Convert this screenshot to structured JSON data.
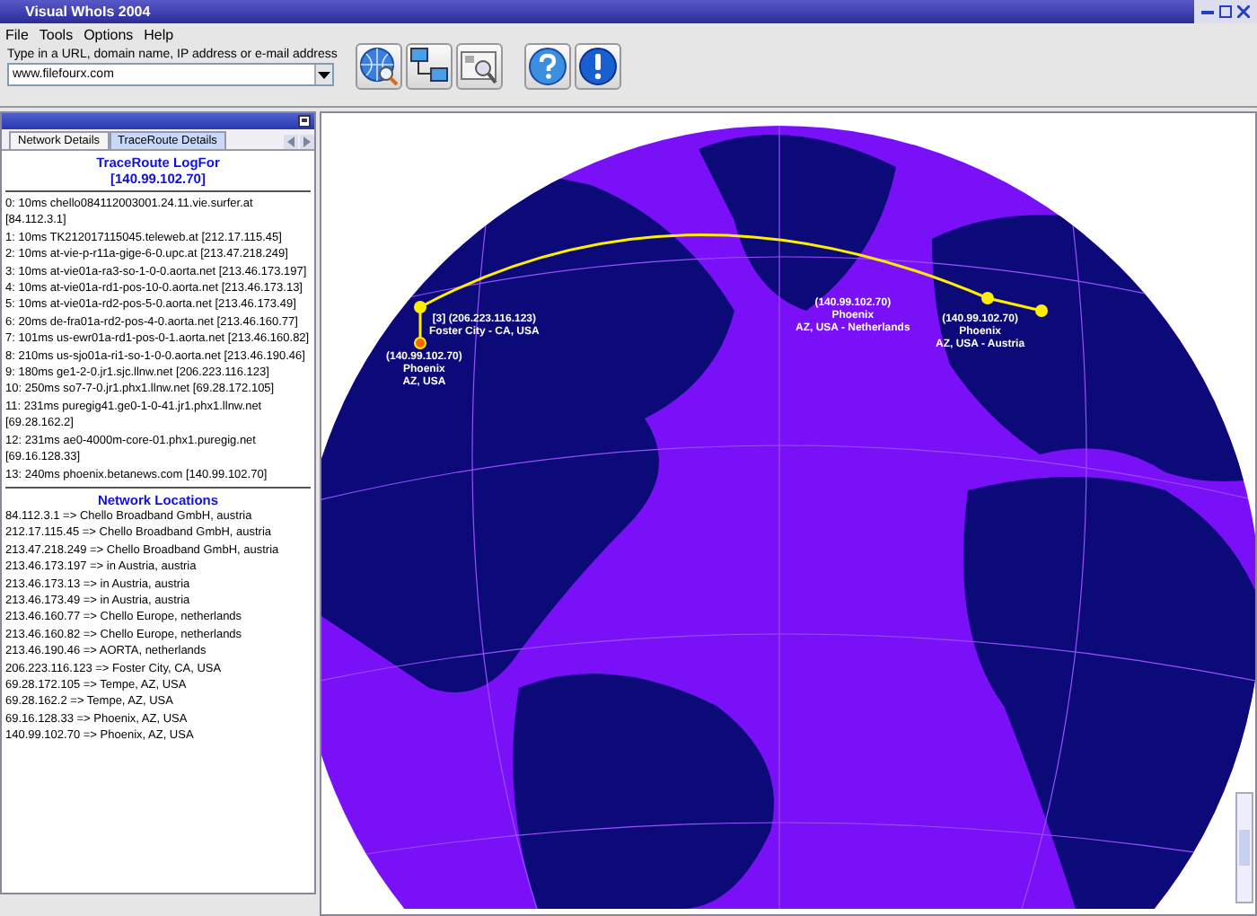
{
  "window": {
    "title": "Visual WhoIs 2004"
  },
  "menu": [
    "File",
    "Tools",
    "Options",
    "Help"
  ],
  "address": {
    "label": "Type in a URL, domain name, IP address or e-mail address",
    "value": "www.filefourx.com"
  },
  "left_panel": {
    "tabs": [
      {
        "label": "Network Details",
        "selected": false
      },
      {
        "label": "TraceRoute Details",
        "selected": true
      }
    ],
    "trace_title": "TraceRoute LogFor",
    "trace_target": "[140.99.102.70]",
    "hops": [
      "0: 10ms  chello084112003001.24.11.vie.surfer.at [84.112.3.1]",
      "1: 10ms  TK212017115045.teleweb.at [212.17.115.45]",
      "2: 10ms  at-vie-p-r11a-gige-6-0.upc.at [213.47.218.249]",
      "3: 10ms  at-vie01a-ra3-so-1-0-0.aorta.net [213.46.173.197]",
      "4: 10ms  at-vie01a-rd1-pos-10-0.aorta.net [213.46.173.13]",
      "5: 10ms  at-vie01a-rd2-pos-5-0.aorta.net [213.46.173.49]",
      "6: 20ms  de-fra01a-rd2-pos-4-0.aorta.net [213.46.160.77]",
      "7: 101ms  us-ewr01a-rd1-pos-0-1.aorta.net [213.46.160.82]",
      "8: 210ms  us-sjo01a-ri1-so-1-0-0.aorta.net [213.46.190.46]",
      "9: 180ms  ge1-2-0.jr1.sjc.llnw.net [206.223.116.123]",
      "10: 250ms  so7-7-0.jr1.phx1.llnw.net [69.28.172.105]",
      "11: 231ms  puregig41.ge0-1-0-41.jr1.phx1.llnw.net [69.28.162.2]",
      "12: 231ms  ae0-4000m-core-01.phx1.puregig.net [69.16.128.33]",
      "13: 240ms  phoenix.betanews.com [140.99.102.70]"
    ],
    "locations_title": "Network Locations",
    "locations": [
      "84.112.3.1 => Chello Broadband GmbH, austria",
      "212.17.115.45 => Chello Broadband GmbH, austria",
      "213.47.218.249 => Chello Broadband GmbH, austria",
      "213.46.173.197 => in Austria, austria",
      "213.46.173.13 => in Austria, austria",
      "213.46.173.49 => in Austria, austria",
      "213.46.160.77 => Chello Europe, netherlands",
      "213.46.160.82 => Chello Europe, netherlands",
      "213.46.190.46 => AORTA, netherlands",
      "206.223.116.123 => Foster City, CA, USA",
      "69.28.172.105 => Tempe, AZ, USA",
      "69.28.162.2 => Tempe, AZ, USA",
      "69.16.128.33 => Phoenix, AZ, USA",
      "140.99.102.70 => Phoenix, AZ, USA"
    ]
  },
  "map_labels": [
    {
      "lines": [
        "[3] (206.223.116.123)",
        "Foster City - CA, USA"
      ]
    },
    {
      "lines": [
        "(140.99.102.70)",
        "Phoenix",
        "AZ, USA"
      ]
    },
    {
      "lines": [
        "(140.99.102.70)",
        "Phoenix",
        "AZ, USA - Netherlands"
      ]
    },
    {
      "lines": [
        "(140.99.102.70)",
        "Phoenix",
        "AZ, USA - Austria"
      ]
    }
  ]
}
